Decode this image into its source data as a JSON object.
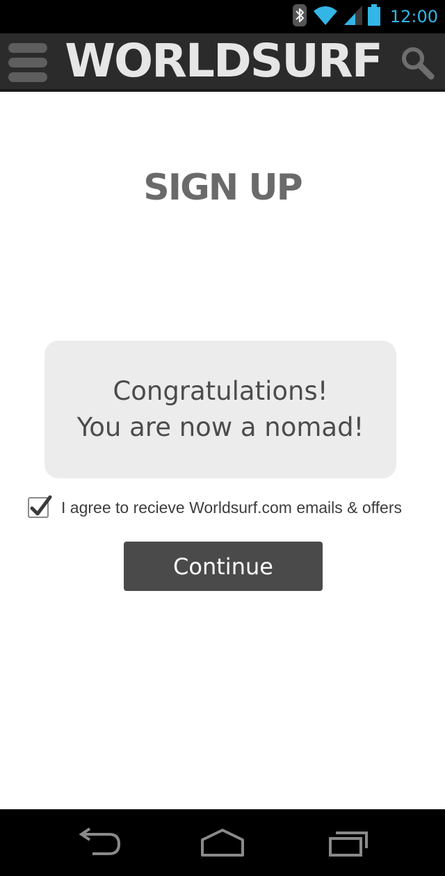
{
  "status_bar": {
    "time": "12:00",
    "icons": [
      "bluetooth-icon",
      "wifi-icon",
      "signal-icon",
      "battery-icon"
    ],
    "accent_color": "#33b5e5"
  },
  "header": {
    "logo_text": "WORLDSURF",
    "menu_icon": "hamburger-menu-icon",
    "search_icon": "search-icon",
    "background": "#2b2b2b"
  },
  "page": {
    "title": "SIGN UP"
  },
  "message": {
    "line1": "Congratulations!",
    "line2": "You are now a nomad!"
  },
  "agreement": {
    "checked": true,
    "label": "I agree to recieve Worldsurf.com emails & offers"
  },
  "actions": {
    "continue_label": "Continue"
  },
  "nav_bar": {
    "icons": [
      "back-icon",
      "home-icon",
      "recent-apps-icon"
    ]
  }
}
